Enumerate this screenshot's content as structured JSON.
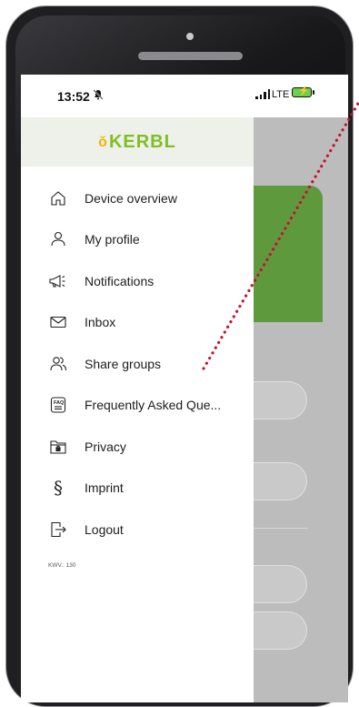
{
  "status_bar": {
    "time": "13:52",
    "network": "LTE"
  },
  "drawer": {
    "logo_mark": "ŏ",
    "logo_text": "KERBL",
    "items": [
      {
        "label": "Device overview",
        "icon": "home-icon"
      },
      {
        "label": "My profile",
        "icon": "user-icon"
      },
      {
        "label": "Notifications",
        "icon": "megaphone-icon"
      },
      {
        "label": "Inbox",
        "icon": "envelope-icon"
      },
      {
        "label": "Share groups",
        "icon": "users-icon"
      },
      {
        "label": "Frequently Asked Que...",
        "icon": "faq-icon"
      },
      {
        "label": "Privacy",
        "icon": "folder-lock-icon"
      },
      {
        "label": "Imprint",
        "icon": "paragraph-icon"
      },
      {
        "label": "Logout",
        "icon": "logout-icon"
      }
    ],
    "version": "KWV.: 130"
  },
  "faq_badge": "FAQ",
  "paragraph_symbol": "§",
  "colors": {
    "brand_green": "#7fbf25",
    "logo_yellow": "#f2b400",
    "app_green": "#5e9a3d",
    "annotation_red": "#c8102e"
  }
}
